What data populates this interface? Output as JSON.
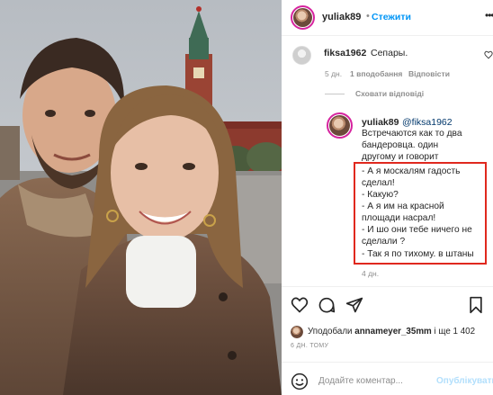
{
  "post": {
    "author": "yuliak89",
    "separator": "•",
    "follow_label": "Стежити",
    "more_icon": "more-horizontal-icon"
  },
  "comment": {
    "user": "fiksa1962",
    "text": "Сепары.",
    "time": "5 дн.",
    "likes": "1 вподобання",
    "reply_label": "Відповісти",
    "hide_replies": "Сховати відповіді"
  },
  "reply": {
    "user": "yuliak89",
    "mention": "@fiksa1962",
    "lines": [
      "Встречаются как то два",
      "бандеровца. один",
      "другому и говорит",
      "- А я москалям гадость",
      "сделал!",
      "- Какую?",
      "- А я им на красной",
      "площади насрал!",
      "- И шо они тебе ничего не",
      "сделали ?",
      "- Так я по тихому. в штаны"
    ],
    "time": "4 дн."
  },
  "likes": {
    "prefix": "Уподобали",
    "user": "annameyer_35mm",
    "suffix": "і ще 1 402"
  },
  "posted_ago": "6 ДН. ТОМУ",
  "composer": {
    "placeholder": "Додайте коментар...",
    "post_label": "Опублікувати"
  },
  "colors": {
    "accent": "#0095f6",
    "highlight_box": "#e0281e",
    "muted": "#8e8e8e"
  }
}
